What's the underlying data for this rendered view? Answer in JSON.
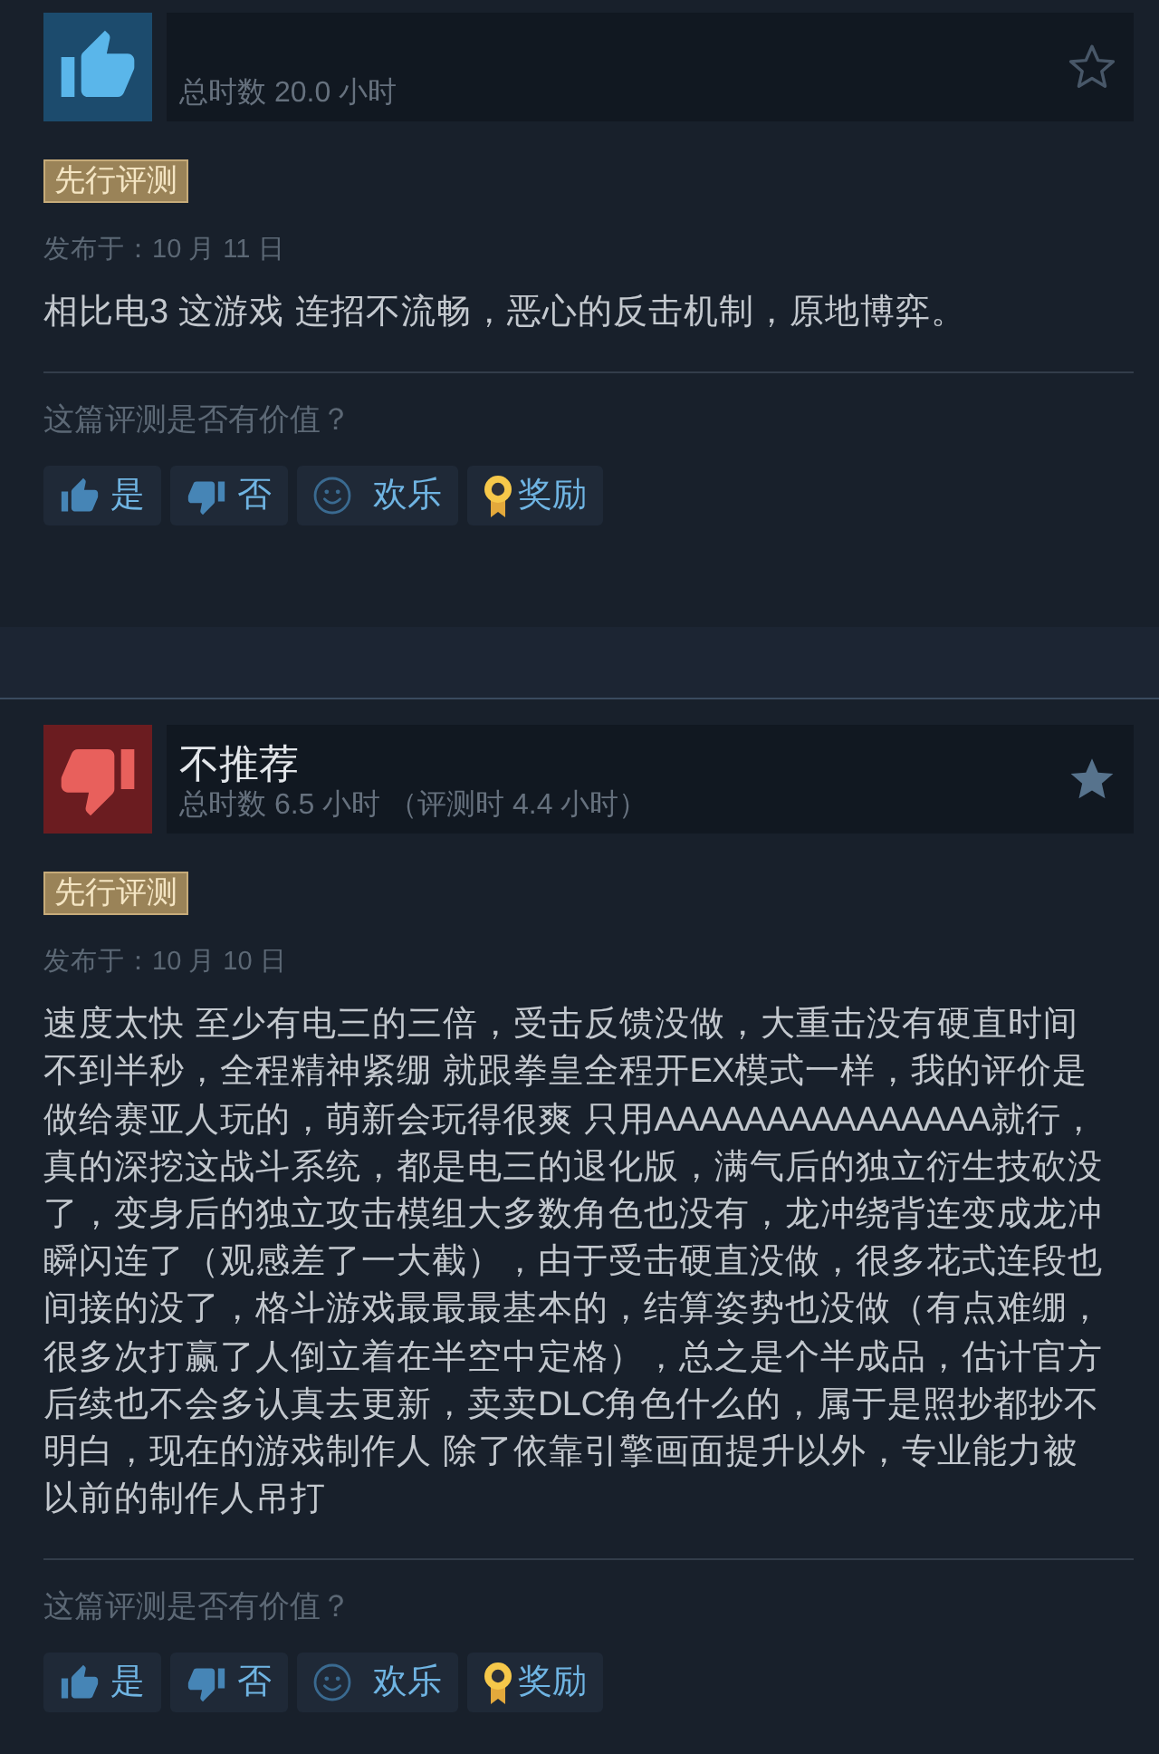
{
  "reviews": [
    {
      "kind": "recommended",
      "playtime": "总时数 20.0 小时",
      "starred": false,
      "tag": "先行评测",
      "date": "发布于：10 月 11 日",
      "body": "相比电3 这游戏 连招不流畅，恶心的反击机制，原地博弈。",
      "helpful_prompt": "这篇评测是否有价值？",
      "actions": [
        {
          "kind": "yes",
          "label": "是"
        },
        {
          "kind": "no",
          "label": "否"
        },
        {
          "kind": "funny",
          "label": "欢乐"
        },
        {
          "kind": "award",
          "label": "奖励"
        }
      ]
    },
    {
      "kind": "not_recommended",
      "title": "不推荐",
      "playtime": "总时数 6.5 小时 （评测时 4.4 小时）",
      "starred": true,
      "tag": "先行评测",
      "date": "发布于：10 月 10 日",
      "body": "速度太快 至少有电三的三倍，受击反馈没做，大重击没有硬直时间不到半秒，全程精神紧绷 就跟拳皇全程开EX模式一样，我的评价是做给赛亚人玩的，萌新会玩得很爽 只用AAAAAAAAAAAAAAA就行，真的深挖这战斗系统，都是电三的退化版，满气后的独立衍生技砍没了，变身后的独立攻击模组大多数角色也没有，龙冲绕背连变成龙冲瞬闪连了（观感差了一大截），由于受击硬直没做，很多花式连段也间接的没了，格斗游戏最最最基本的，结算姿势也没做（有点难绷，很多次打赢了人倒立着在半空中定格），总之是个半成品，估计官方后续也不会多认真去更新，卖卖DLC角色什么的，属于是照抄都抄不明白，现在的游戏制作人 除了依靠引擎画面提升以外，专业能力被以前的制作人吊打",
      "helpful_prompt": "这篇评测是否有价值？",
      "actions": [
        {
          "kind": "yes",
          "label": "是"
        },
        {
          "kind": "no",
          "label": "否"
        },
        {
          "kind": "funny",
          "label": "欢乐"
        },
        {
          "kind": "award",
          "label": "奖励"
        }
      ]
    }
  ]
}
